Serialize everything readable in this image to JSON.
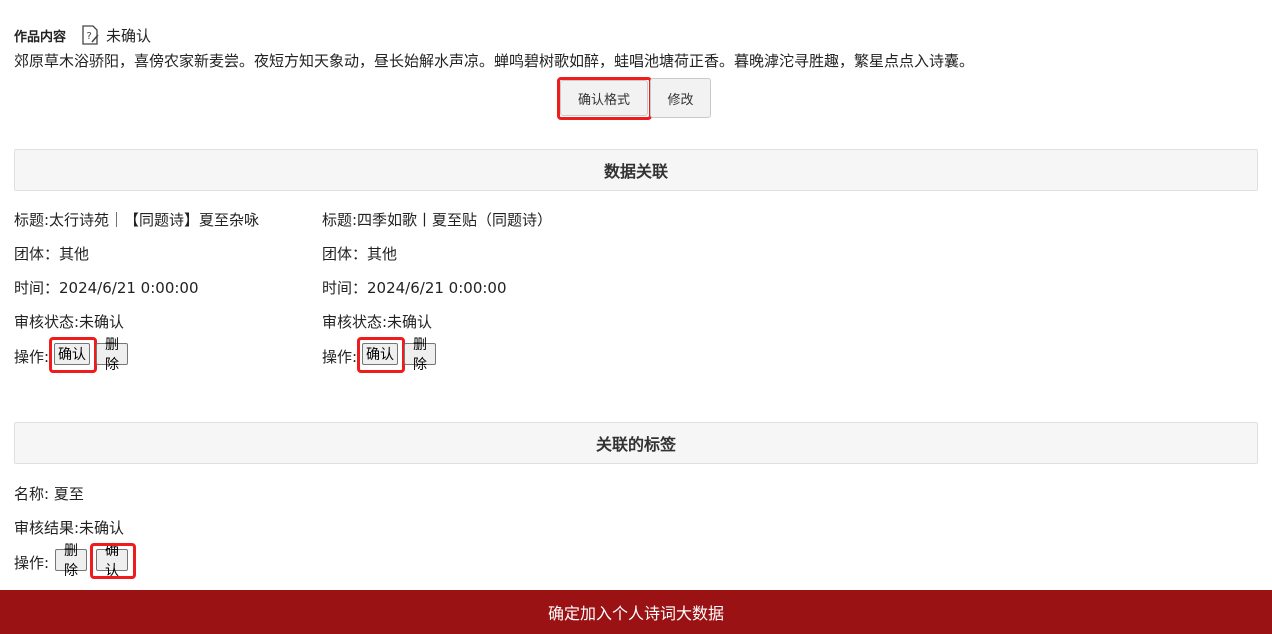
{
  "content": {
    "label": "作品内容",
    "status": "未确认",
    "poem": "郊原草木浴骄阳，喜傍农家新麦尝。夜短方知天象动，昼长始解水声凉。蝉鸣碧树歌如醉，蛙唱池塘荷正香。暮晚滹沱寻胜趣，繁星点点入诗囊。",
    "confirm_format_label": "确认格式",
    "edit_label": "修改"
  },
  "data_link": {
    "title": "数据关联",
    "items": [
      {
        "title": "标题:太行诗苑｜【同题诗】夏至杂咏",
        "group": "团体：其他",
        "time": "时间：2024/6/21 0:00:00",
        "review": "审核状态:未确认",
        "action_label": "操作:",
        "confirm_label": "确认",
        "delete_label": "删除"
      },
      {
        "title": "标题:四季如歌丨夏至贴（同题诗）",
        "group": "团体：其他",
        "time": "时间：2024/6/21 0:00:00",
        "review": "审核状态:未确认",
        "action_label": "操作:",
        "confirm_label": "确认",
        "delete_label": "删除"
      }
    ]
  },
  "tags": {
    "title": "关联的标签",
    "name": "名称: 夏至",
    "review": "审核结果:未确认",
    "action_label": "操作:",
    "delete_label": "删除",
    "confirm_label": "确认"
  },
  "footer": {
    "submit_label": "确定加入个人诗词大数据"
  },
  "colors": {
    "accent_red": "#9b1214",
    "highlight_red": "#ee1c1c"
  }
}
